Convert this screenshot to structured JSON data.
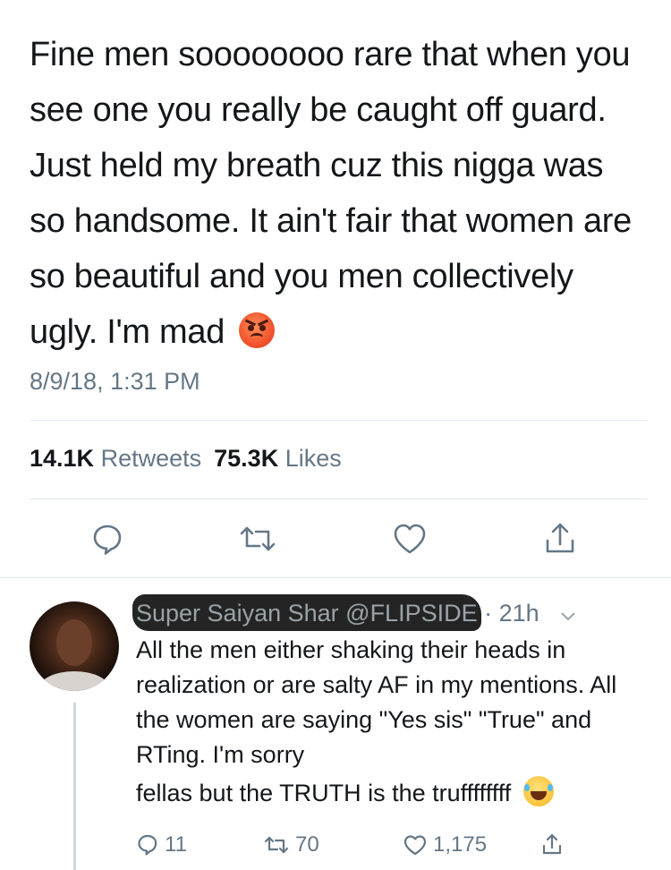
{
  "tweet": {
    "text": "Fine men soooooooo rare that when you see one you really be caught off guard.  Just held my breath cuz this nigga was so handsome. It ain't fair that women are so beautiful and you men collectively ugly.  I'm mad",
    "emoji": "angry-face-icon",
    "timestamp": "8/9/18, 1:31 PM",
    "retweets_count": "14.1K",
    "retweets_label": "Retweets",
    "likes_count": "75.3K",
    "likes_label": "Likes"
  },
  "reply": {
    "author_name": "Super Saiyan Shar",
    "author_handle": "@FLIPSIDE",
    "separator": "·",
    "time": "21h",
    "text": "All the men either shaking their heads in realization or are salty AF in my mentions. All the women are saying \"Yes sis\" \"True\" and RTing. I'm sorry",
    "text_last_line": "fellas but the TRUTH is the truffffffff",
    "emoji": "laughing-face-icon",
    "replies": "11",
    "retweets": "70",
    "likes": "1,175"
  },
  "colors": {
    "text": "#14171a",
    "secondary": "#657786",
    "divider": "#e1e8ed"
  }
}
